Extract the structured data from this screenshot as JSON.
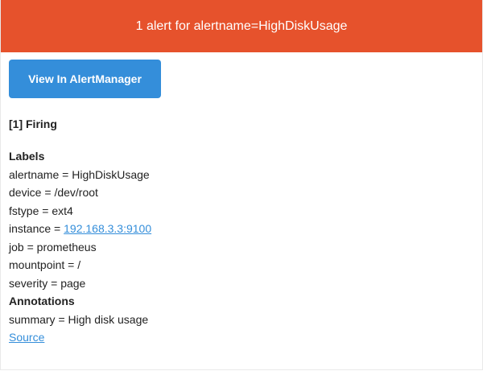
{
  "header": {
    "title": "1 alert for alertname=HighDiskUsage"
  },
  "button": {
    "label": "View In AlertManager"
  },
  "firing": {
    "title": "[1] Firing"
  },
  "labels": {
    "heading": "Labels",
    "items": [
      {
        "key": "alertname",
        "sep": " = ",
        "value": "HighDiskUsage"
      },
      {
        "key": "device",
        "sep": " = ",
        "value": "/dev/root"
      },
      {
        "key": "fstype",
        "sep": " = ",
        "value": "ext4"
      },
      {
        "key": "instance",
        "sep": " = ",
        "value": "192.168.3.3:9100"
      },
      {
        "key": "job",
        "sep": " = ",
        "value": "prometheus"
      },
      {
        "key": "mountpoint",
        "sep": " = ",
        "value": "/"
      },
      {
        "key": "severity",
        "sep": " = ",
        "value": "page"
      }
    ]
  },
  "annotations": {
    "heading": "Annotations",
    "items": [
      {
        "key": "summary",
        "sep": " = ",
        "value": "High disk usage"
      }
    ]
  },
  "source": {
    "label": "Source"
  },
  "colors": {
    "header_bg": "#e6522c",
    "button_bg": "#348eda",
    "link": "#348eda"
  }
}
